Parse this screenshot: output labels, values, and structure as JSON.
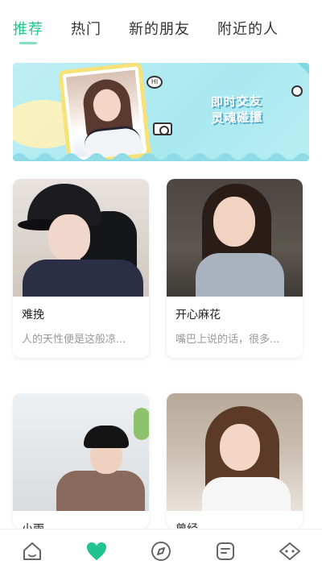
{
  "tabs": [
    {
      "label": "推荐",
      "active": true
    },
    {
      "label": "热门",
      "active": false
    },
    {
      "label": "新的朋友",
      "active": false
    },
    {
      "label": "附近的人",
      "active": false
    }
  ],
  "banner": {
    "line1": "即时交友",
    "line2": "灵魂碰撞",
    "bubble_text": "HI"
  },
  "cards": [
    {
      "name": "难挽",
      "bio": "人的天性便是这般凉..."
    },
    {
      "name": "开心麻花",
      "bio": "嘴巴上说的话，很多..."
    },
    {
      "name": "小雨",
      "bio": ""
    },
    {
      "name": "曾经",
      "bio": ""
    }
  ],
  "bottom_nav": [
    {
      "icon": "home-icon",
      "active": false
    },
    {
      "icon": "heart-icon",
      "active": true
    },
    {
      "icon": "compass-icon",
      "active": false
    },
    {
      "icon": "message-icon",
      "active": false
    },
    {
      "icon": "profile-icon",
      "active": false
    }
  ],
  "colors": {
    "accent": "#21c48e",
    "banner_bg": "#b8eef3",
    "muted_text": "#999999"
  }
}
